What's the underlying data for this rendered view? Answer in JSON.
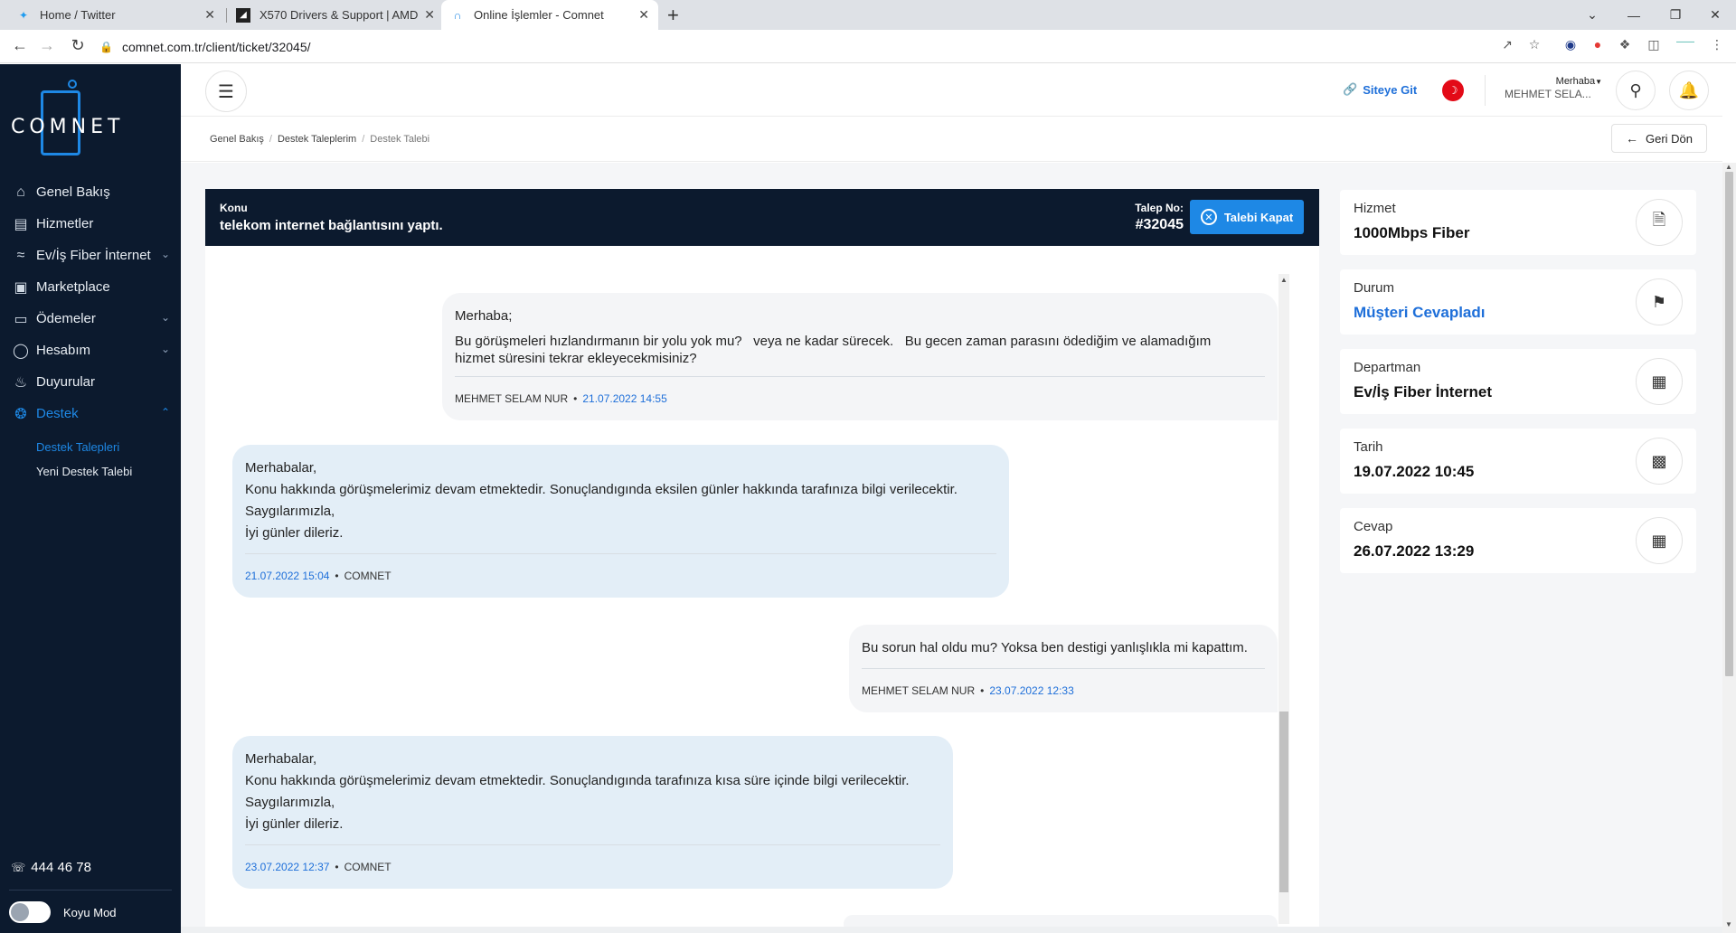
{
  "browser": {
    "tabs": [
      {
        "title": "Home / Twitter",
        "icon": "twitter-icon"
      },
      {
        "title": "X570 Drivers & Support | AMD",
        "icon": "amd-icon"
      },
      {
        "title": "Online İşlemler - Comnet",
        "icon": "comnet-icon"
      }
    ],
    "url": "comnet.com.tr/client/ticket/32045/"
  },
  "sidebar": {
    "logo_text": "COMNET",
    "menu": [
      {
        "label": "Genel Bakış",
        "icon": "home-icon"
      },
      {
        "label": "Hizmetler",
        "icon": "services-icon"
      },
      {
        "label": "Ev/İş Fiber İnternet",
        "icon": "wifi-icon"
      },
      {
        "label": "Marketplace",
        "icon": "store-icon"
      },
      {
        "label": "Ödemeler",
        "icon": "wallet-icon"
      },
      {
        "label": "Hesabım",
        "icon": "user-icon"
      },
      {
        "label": "Duyurular",
        "icon": "bell-icon"
      },
      {
        "label": "Destek",
        "icon": "support-icon"
      }
    ],
    "submenu": [
      "Destek Talepleri",
      "Yeni Destek Talebi"
    ],
    "phone": "444 46 78",
    "dark_mode_label": "Koyu Mod"
  },
  "header": {
    "site_link": "Siteye Git",
    "greeting": "Merhaba",
    "user_name": "MEHMET SELA..."
  },
  "breadcrumb": [
    "Genel Bakış",
    "Destek Taleplerim",
    "Destek Talebi"
  ],
  "back_button": "Geri Dön",
  "ticket": {
    "subject_label": "Konu",
    "subject": "telekom internet bağlantısını yaptı.",
    "number_label": "Talep No:",
    "number": "#32045",
    "close_label": "Talebi Kapat",
    "messages": [
      {
        "type": "user",
        "lines": [
          "Merhaba;",
          "Bu görüşmeleri hızlandırmanın bir yolu yok mu?   veya ne kadar sürecek.   Bu gecen zaman parasını ödediğim ve alamadığım",
          "hizmet süresini tekrar ekleyecekmisiniz?"
        ],
        "author": "MEHMET SELAM NUR",
        "date": "21.07.2022 14:55"
      },
      {
        "type": "staff",
        "lines": [
          "Merhabalar,",
          "Konu hakkında görüşmelerimiz devam etmektedir. Sonuçlandıgında eksilen günler hakkında tarafınıza bilgi verilecektir.",
          "Saygılarımızla,",
          "İyi günler dileriz."
        ],
        "author": "COMNET",
        "date": "21.07.2022 15:04"
      },
      {
        "type": "user",
        "lines": [
          "Bu sorun hal oldu mu? Yoksa ben destigi yanlışlıkla mi kapattım."
        ],
        "author": "MEHMET SELAM NUR",
        "date": "23.07.2022 12:33"
      },
      {
        "type": "staff",
        "lines": [
          "Merhabalar,",
          "Konu hakkında görüşmelerimiz devam etmektedir. Sonuçlandıgında tarafınıza kısa süre içinde bilgi verilecektir.",
          "Saygılarımızla,",
          "İyi günler dileriz."
        ],
        "author": "COMNET",
        "date": "23.07.2022 12:37"
      }
    ]
  },
  "info_cards": [
    {
      "label": "Hizmet",
      "value": "1000Mbps Fiber",
      "icon": "document-icon",
      "highlight": false
    },
    {
      "label": "Durum",
      "value": "Müşteri Cevapladı",
      "icon": "flag-icon",
      "highlight": true
    },
    {
      "label": "Departman",
      "value": "Ev/İş Fiber İnternet",
      "icon": "building-icon",
      "highlight": false
    },
    {
      "label": "Tarih",
      "value": "19.07.2022 10:45",
      "icon": "calendar-icon",
      "highlight": false
    },
    {
      "label": "Cevap",
      "value": "26.07.2022 13:29",
      "icon": "calendar-add-icon",
      "highlight": false
    }
  ]
}
